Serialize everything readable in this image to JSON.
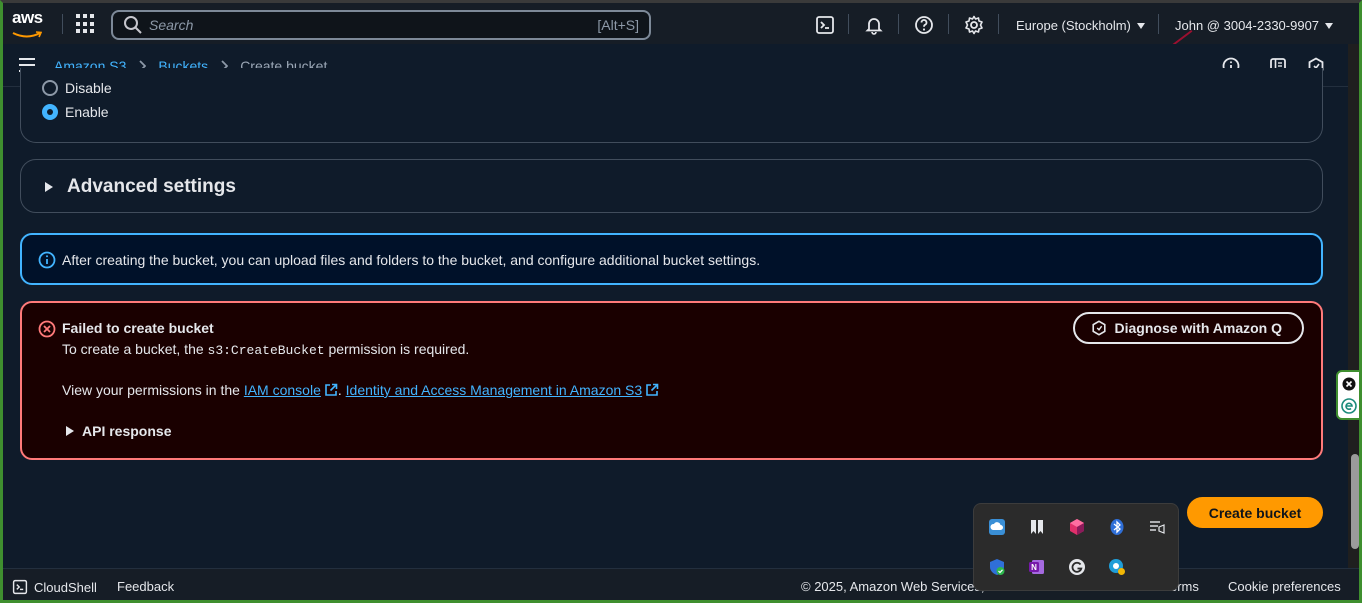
{
  "topnav": {
    "logo": "aws",
    "search_placeholder": "Search",
    "search_shortcut": "[Alt+S]",
    "region": "Europe (Stockholm)",
    "account": "John @ 3004-2330-9907",
    "icons": [
      "cloudshell-icon",
      "bell-icon",
      "help-icon",
      "gear-icon"
    ]
  },
  "breadcrumb": {
    "items": [
      "Amazon S3",
      "Buckets"
    ],
    "current": "Create bucket"
  },
  "versioning": {
    "option_disable": "Disable",
    "option_enable": "Enable",
    "selected": "Enable"
  },
  "advanced": {
    "title": "Advanced settings"
  },
  "info_alert": {
    "text": "After creating the bucket, you can upload files and folders to the bucket, and configure additional bucket settings."
  },
  "error_alert": {
    "title": "Failed to create bucket",
    "line1_pre": "To create a bucket, the ",
    "line1_code": "s3:CreateBucket",
    "line1_post": " permission is required.",
    "line2_pre": "View your permissions in the ",
    "link1": "IAM console",
    "sep": ". ",
    "link2": "Identity and Access Management in Amazon S3",
    "api_response": "API response",
    "diagnose_label": "Diagnose with Amazon Q"
  },
  "actions": {
    "create_label": "Create bucket"
  },
  "footer": {
    "cloudshell": "CloudShell",
    "feedback": "Feedback",
    "copyright": "© 2025, Amazon Web Services, I",
    "terms": "erms",
    "cookie": "Cookie preferences"
  },
  "colors": {
    "accent_blue": "#42b4ff",
    "primary_orange": "#ff9900",
    "error_red": "#ff7a7a"
  }
}
